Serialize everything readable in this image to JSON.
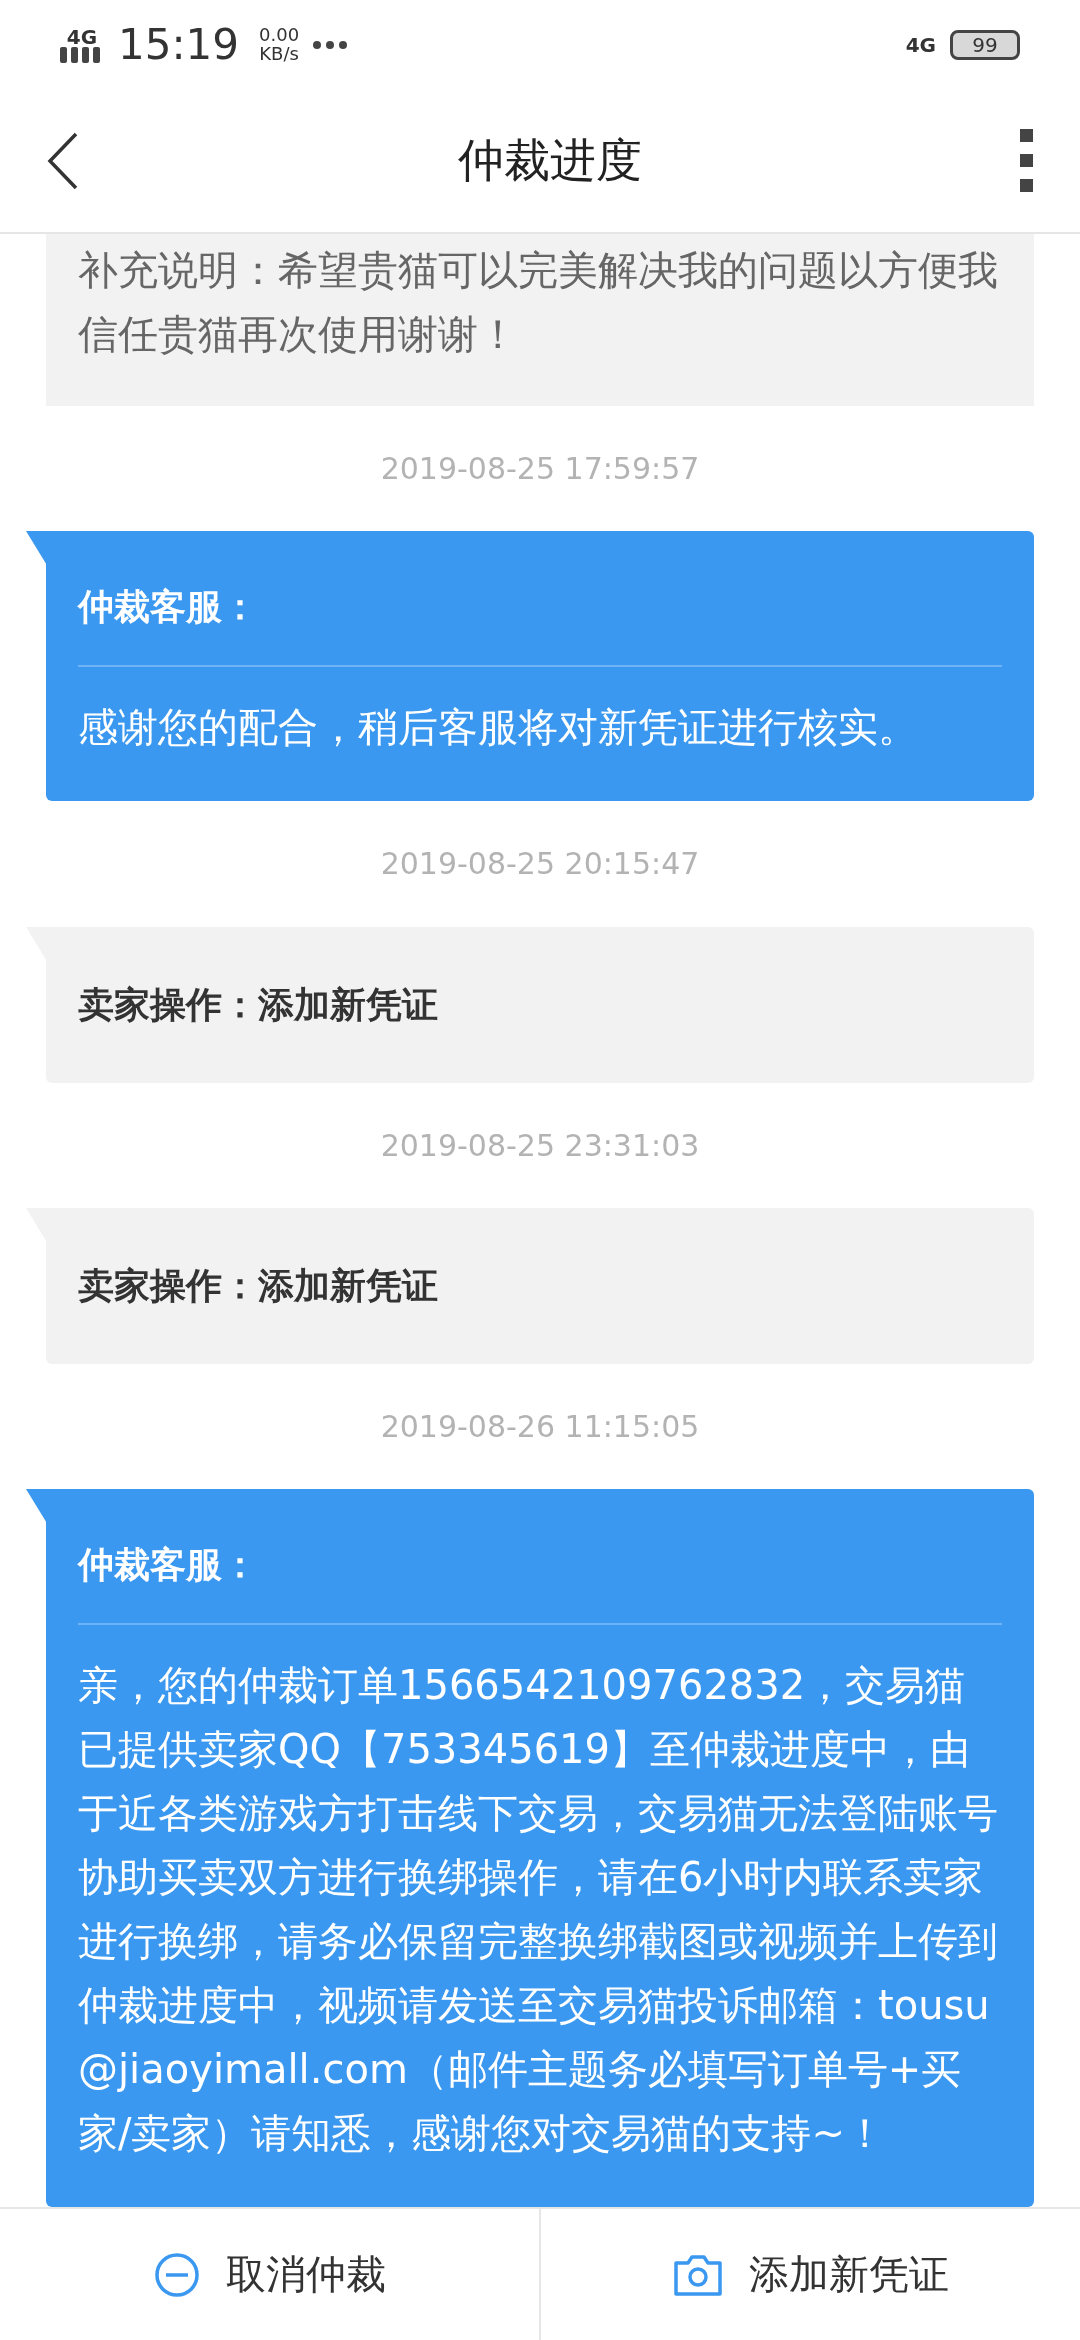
{
  "status_bar": {
    "network": "4G",
    "time": "15:19",
    "speed": "0.00",
    "speed_unit": "KB/s",
    "network_right": "4G",
    "battery": "99"
  },
  "header": {
    "title": "仲裁进度"
  },
  "messages": [
    {
      "kind": "note",
      "text": "补充说明：希望贵猫可以完美解决我的问题以方便我信任贵猫再次使用谢谢！"
    },
    {
      "kind": "time",
      "text": "2019-08-25 17:59:57"
    },
    {
      "kind": "service",
      "sender": "仲裁客服：",
      "text": "感谢您的配合，稍后客服将对新凭证进行核实。"
    },
    {
      "kind": "time",
      "text": "2019-08-25 20:15:47"
    },
    {
      "kind": "seller",
      "text": "卖家操作：添加新凭证"
    },
    {
      "kind": "time",
      "text": "2019-08-25 23:31:03"
    },
    {
      "kind": "seller",
      "text": "卖家操作：添加新凭证"
    },
    {
      "kind": "time",
      "text": "2019-08-26 11:15:05"
    },
    {
      "kind": "service",
      "sender": "仲裁客服：",
      "text": "亲，您的仲裁订单1566542109762832，交易猫已提供卖家QQ【753345619】至仲裁进度中，由于近各类游戏方打击线下交易，交易猫无法登陆账号协助买卖双方进行换绑操作，请在6小时内联系卖家进行换绑，请务必保留完整换绑截图或视频并上传到仲裁进度中，视频请发送至交易猫投诉邮箱：tousu@jiaoyimall.com（邮件主题务必填写订单号+买家/卖家）请知悉，感谢您对交易猫的支持~！"
    }
  ],
  "footer": {
    "buttons": [
      {
        "kind": "cancel",
        "label": "取消仲裁"
      },
      {
        "kind": "camera",
        "label": "添加新凭证"
      }
    ]
  }
}
